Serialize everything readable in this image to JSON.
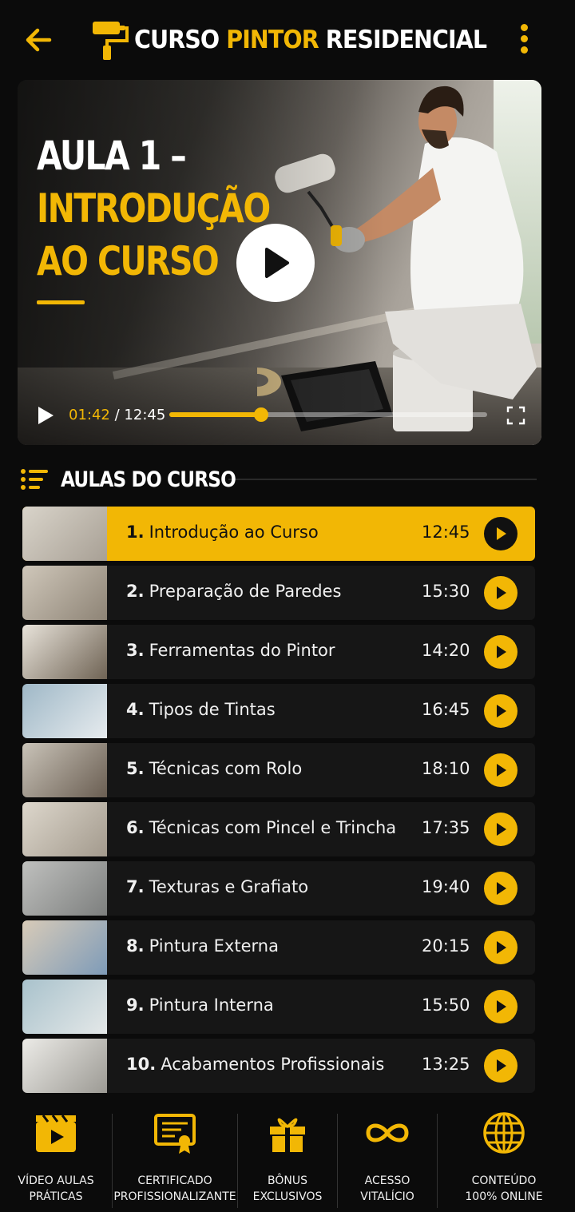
{
  "header": {
    "title_part1": "CURSO",
    "title_part2": "PINTOR",
    "title_part3": "RESIDENCIAL",
    "back_icon": "arrow-left-icon",
    "menu_icon": "kebab-menu-icon",
    "logo_icon": "paint-roller-icon"
  },
  "video": {
    "title_line1": "AULA 1 –",
    "title_line2": "INTRODUÇÃO",
    "title_line3": "AO CURSO",
    "current_time": "01:42",
    "separator": "/",
    "duration": "12:45",
    "progress": 0.29
  },
  "section": {
    "title": "AULAS DO CURSO",
    "icon": "list-icon"
  },
  "lessons": [
    {
      "num": "1.",
      "title": "Introdução ao Curso",
      "duration": "12:45",
      "active": true
    },
    {
      "num": "2.",
      "title": "Preparação de Paredes",
      "duration": "15:30",
      "active": false
    },
    {
      "num": "3.",
      "title": "Ferramentas do Pintor",
      "duration": "14:20",
      "active": false
    },
    {
      "num": "4.",
      "title": "Tipos de Tintas",
      "duration": "16:45",
      "active": false
    },
    {
      "num": "5.",
      "title": "Técnicas com Rolo",
      "duration": "18:10",
      "active": false
    },
    {
      "num": "6.",
      "title": "Técnicas com Pincel e Trincha",
      "duration": "17:35",
      "active": false
    },
    {
      "num": "7.",
      "title": "Texturas e Grafiato",
      "duration": "19:40",
      "active": false
    },
    {
      "num": "8.",
      "title": "Pintura Externa",
      "duration": "20:15",
      "active": false
    },
    {
      "num": "9.",
      "title": "Pintura Interna",
      "duration": "15:50",
      "active": false
    },
    {
      "num": "10.",
      "title": "Acabamentos Profissionais",
      "duration": "13:25",
      "active": false
    }
  ],
  "features": [
    {
      "line1": "VÍDEO AULAS",
      "line2": "PRÁTICAS",
      "icon": "video-clapper-icon"
    },
    {
      "line1": "CERTIFICADO",
      "line2": "PROFISSIONALIZANTE",
      "icon": "certificate-icon"
    },
    {
      "line1": "BÔNUS",
      "line2": "EXCLUSIVOS",
      "icon": "gift-icon"
    },
    {
      "line1": "ACESSO",
      "line2": "VITALÍCIO",
      "icon": "infinity-icon"
    },
    {
      "line1": "CONTEÚDO",
      "line2": "100% ONLINE",
      "icon": "globe-icon"
    }
  ],
  "colors": {
    "accent": "#f2b705",
    "background": "#0b0b0b",
    "row": "#161616"
  }
}
